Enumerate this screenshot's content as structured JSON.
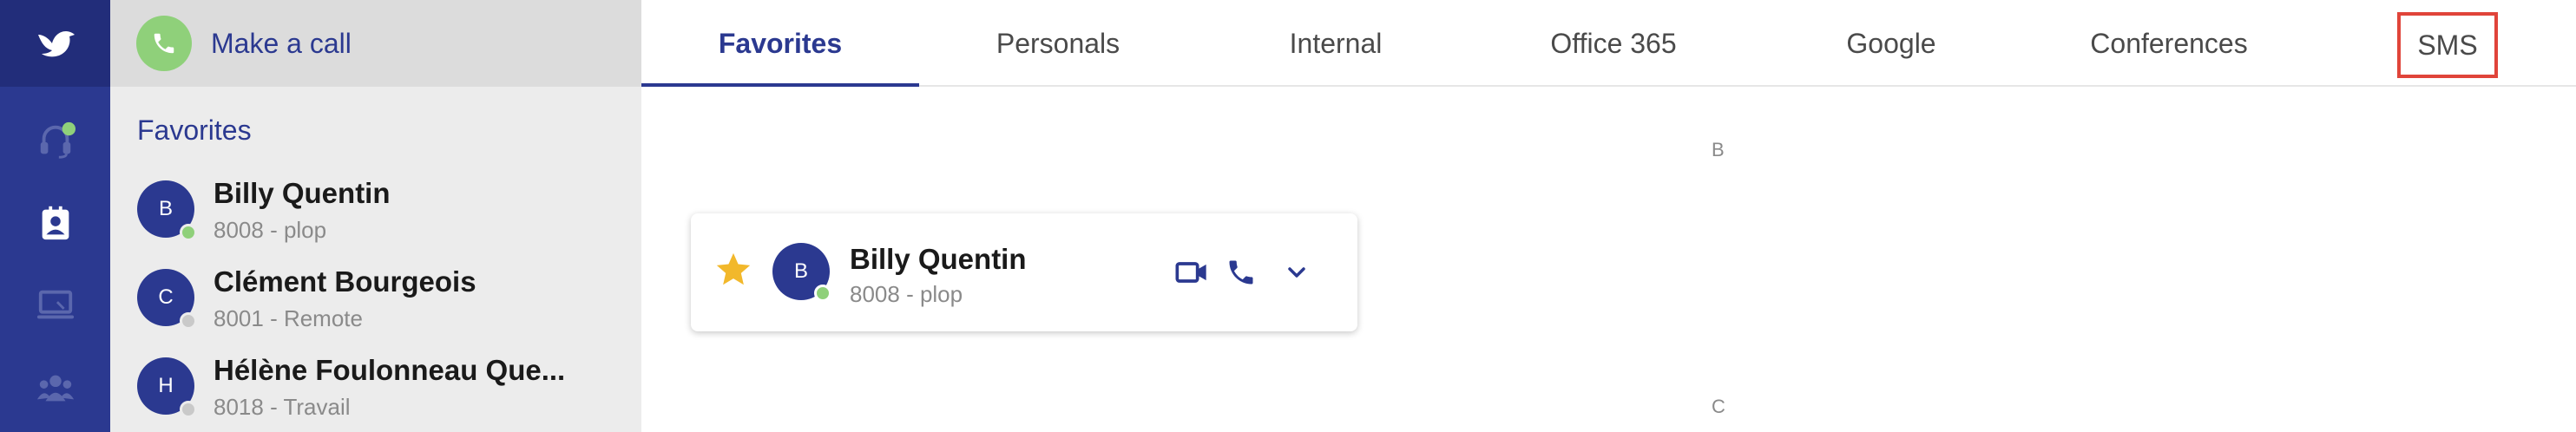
{
  "app": {
    "brand_color": "#2b3990",
    "accent_green": "#8fd07a"
  },
  "rail": {
    "logo_icon": "bird-logo-icon",
    "items": [
      {
        "icon": "headset-icon",
        "badge": "online"
      },
      {
        "icon": "contacts-book-icon"
      },
      {
        "icon": "computer-icon"
      },
      {
        "icon": "group-icon"
      }
    ]
  },
  "call": {
    "label": "Make a call",
    "icon": "phone-icon"
  },
  "panel": {
    "heading": "Favorites",
    "contacts": [
      {
        "initial": "B",
        "name": "Billy Quentin",
        "sub": "8008 - plop",
        "status": "online",
        "status_color": "#8fd07a"
      },
      {
        "initial": "C",
        "name": "Clément Bourgeois",
        "sub": "8001 - Remote",
        "status": "offline",
        "status_color": "#c9c9c9"
      },
      {
        "initial": "H",
        "name": "Hélène Foulonneau Que...",
        "sub": "8018 - Travail",
        "status": "offline",
        "status_color": "#c9c9c9"
      }
    ]
  },
  "tabs": [
    {
      "label": "Favorites",
      "active": true
    },
    {
      "label": "Personals"
    },
    {
      "label": "Internal"
    },
    {
      "label": "Office 365"
    },
    {
      "label": "Google"
    },
    {
      "label": "Conferences"
    },
    {
      "label": "SMS",
      "highlighted": true,
      "highlight_color": "#e0443a"
    }
  ],
  "main": {
    "section_letters": [
      "B",
      "C"
    ],
    "card": {
      "favorite": true,
      "star_color": "#f2b82b",
      "initial": "B",
      "name": "Billy Quentin",
      "sub": "8008 - plop",
      "status": "online",
      "actions": [
        "video-icon",
        "phone-icon",
        "chevron-down-icon"
      ]
    }
  }
}
